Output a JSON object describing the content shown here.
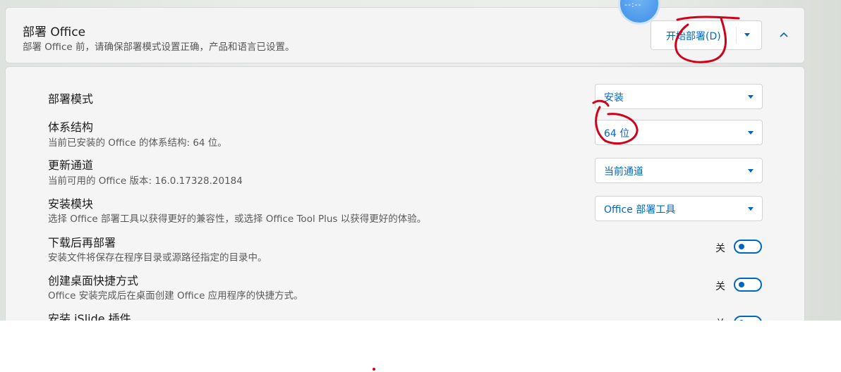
{
  "header": {
    "title": "部署 Office",
    "description": "部署 Office 前，请确保部署模式设置正确，产品和语言已设置。",
    "deploy_button": "开始部署(D)",
    "avatar_text": "--:--"
  },
  "settings": {
    "deploy_mode": {
      "title": "部署模式",
      "value": "安装"
    },
    "architecture": {
      "title": "体系结构",
      "description": "当前已安装的 Office 的体系结构: 64 位。",
      "value": "64 位"
    },
    "update_channel": {
      "title": "更新通道",
      "description": "当前可用的 Office 版本: 16.0.17328.20184",
      "value": "当前通道"
    },
    "install_module": {
      "title": "安装模块",
      "description": "选择 Office 部署工具以获得更好的兼容性，或选择 Office Tool Plus 以获得更好的体验。",
      "value": "Office 部署工具"
    },
    "download_then_deploy": {
      "title": "下载后再部署",
      "description": "安装文件将保存在程序目录或源路径指定的目录中。",
      "state": "关"
    },
    "desktop_shortcuts": {
      "title": "创建桌面快捷方式",
      "description": "Office 安装完成后在桌面创建 Office 应用程序的快捷方式。",
      "state": "关"
    },
    "islide_plugin": {
      "title": "安装 iSlide 插件",
      "state": "关"
    }
  },
  "colors": {
    "accent": "#0067c0",
    "annotation": "#d0021b"
  }
}
